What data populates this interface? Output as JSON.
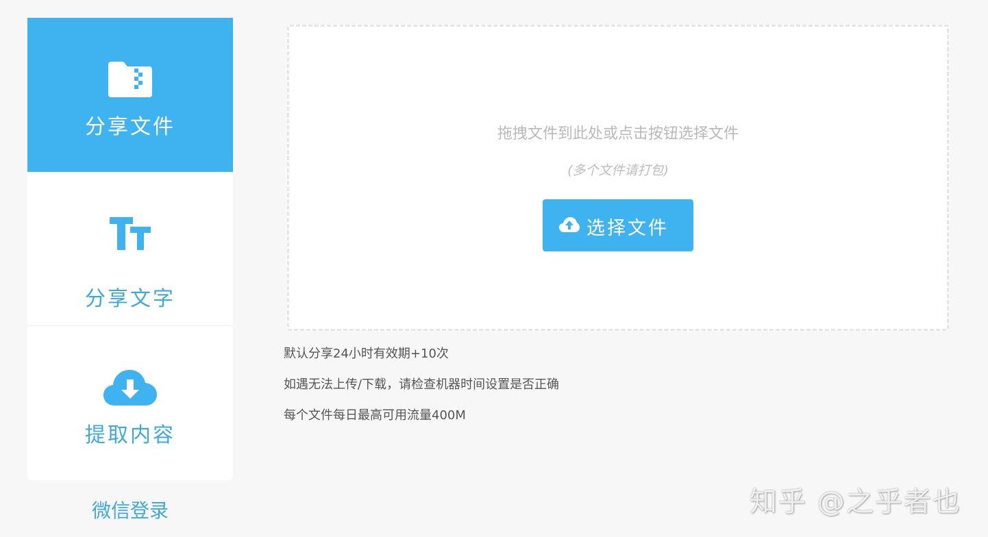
{
  "sidebar": {
    "items": [
      {
        "label": "分享文件",
        "icon": "folder-zip-icon",
        "active": true
      },
      {
        "label": "分享文字",
        "icon": "text-size-icon",
        "active": false
      },
      {
        "label": "提取内容",
        "icon": "cloud-download-icon",
        "active": false
      }
    ],
    "wechat_login": "微信登录"
  },
  "upload": {
    "hint": "拖拽文件到此处或点击按钮选择文件",
    "sub_hint": "(多个文件请打包)",
    "button_label": "选择文件",
    "button_icon": "cloud-upload-icon"
  },
  "notes": [
    "默认分享24小时有效期+10次",
    "如遇无法上传/下载，请检查机器时间设置是否正确",
    "每个文件每日最高可用流量400M"
  ],
  "watermark": "知乎 @之乎者也",
  "colors": {
    "accent": "#3fb3ef",
    "background": "#f7f7f7",
    "label_blue": "#3fa9dd",
    "hint_gray": "#b9b9b9",
    "note_text": "#555555"
  }
}
